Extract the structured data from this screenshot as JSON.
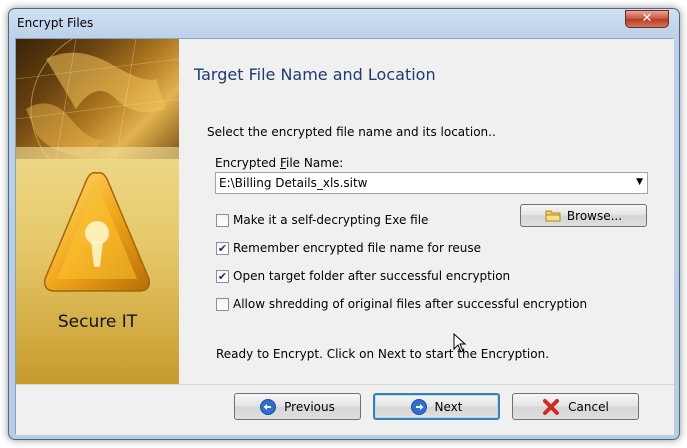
{
  "window": {
    "title": "Encrypt Files",
    "close_glyph": "✕"
  },
  "sidebar": {
    "image": "gold-globe-map",
    "icon": "warning-keyhole-icon",
    "label": "Secure IT"
  },
  "content": {
    "page_title": "Target File Name and Location",
    "instruction": "Select the encrypted file name and its location..",
    "field_label_prefix": "Encrypted ",
    "field_label_accel": "F",
    "field_label_suffix": "ile Name:",
    "file_name_value": "E:\\Billing Details_xls.sitw",
    "browse_label": "Browse...",
    "options": [
      {
        "label": "Make it a self-decrypting Exe file",
        "checked": false
      },
      {
        "label": "Remember encrypted file name for reuse",
        "checked": true
      },
      {
        "label": "Open target folder after successful encryption",
        "checked": true
      },
      {
        "label": "Allow shredding of original files after successful encryption",
        "checked": false
      }
    ],
    "status": "Ready to Encrypt. Click on Next to start  the Encryption."
  },
  "footer": {
    "previous_label": "Previous",
    "next_label": "Next",
    "cancel_label": "Cancel"
  },
  "colors": {
    "title_blue": "#1e3c6e",
    "button_blue": "#2e6fcf",
    "cancel_red": "#d22a1e"
  }
}
